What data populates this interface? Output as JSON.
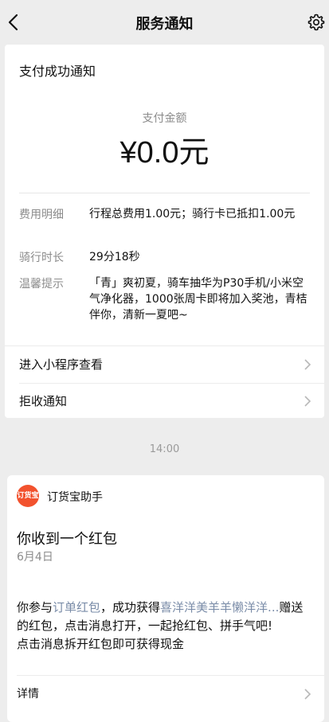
{
  "header": {
    "title": "服务通知",
    "back_icon": "chevron-left-icon",
    "settings_icon": "gear-icon"
  },
  "payment_card": {
    "title": "支付成功通知",
    "amount_label": "支付金额",
    "amount": "¥0.0元",
    "rows": [
      {
        "label": "费用明细",
        "value": "行程总费用1.00元；骑行卡已抵扣1.00元"
      },
      {
        "label": "骑行时长",
        "value": "29分18秒"
      },
      {
        "label": "温馨提示",
        "value": "「青」爽初夏，骑车抽华为P30手机/小米空气净化器，1000张周卡即将加入奖池，青桔伴你，清新一夏吧~"
      }
    ],
    "actions": [
      {
        "label": "进入小程序查看"
      },
      {
        "label": "拒收通知"
      }
    ]
  },
  "timestamp": "14:00",
  "message_card": {
    "logo_text": "订货宝",
    "sender": "订货宝助手",
    "title": "你收到一个红包",
    "date": "6月4日",
    "body": {
      "p1": "你参与",
      "link1": "订单红包",
      "p2": "，成功获得",
      "link2": "喜洋洋美羊羊懒洋洋...",
      "p3": "赠送的红包，点击消息打开，一起抢红包、拼手气吧!",
      "line2": "点击消息拆开红包即可获得现金"
    },
    "detail_label": "详情"
  },
  "colors": {
    "background": "#ededed",
    "card": "#ffffff",
    "link": "#7a8ca8",
    "logo": "#f2522e",
    "muted": "#8c8c8c"
  }
}
